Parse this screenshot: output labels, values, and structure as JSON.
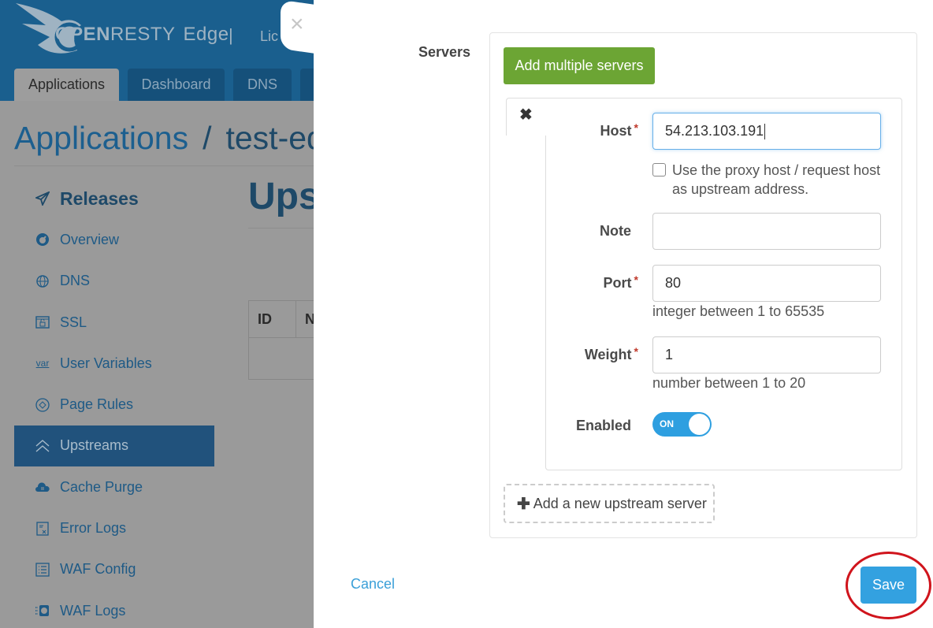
{
  "app": {
    "brand_open": "OPEN",
    "brand_resty": "RESTY",
    "brand_edge": "Edge",
    "separator": "|",
    "license_partial": "Lic"
  },
  "nav_tabs": [
    {
      "label": "Applications",
      "active": true
    },
    {
      "label": "Dashboard",
      "active": false
    },
    {
      "label": "DNS",
      "active": false
    }
  ],
  "breadcrumb": {
    "root": "Applications",
    "separator": "/",
    "current_partial": "test-ed"
  },
  "sidebar": {
    "items": [
      {
        "label": "Releases",
        "icon": "paper-plane-icon"
      },
      {
        "label": "Overview",
        "icon": "gauge-icon"
      },
      {
        "label": "DNS",
        "icon": "dns-globe-icon"
      },
      {
        "label": "SSL",
        "icon": "ssl-lock-icon"
      },
      {
        "label": "User Variables",
        "icon": "var-icon"
      },
      {
        "label": "Page Rules",
        "icon": "page-rules-icon"
      },
      {
        "label": "Upstreams",
        "icon": "upstreams-icon",
        "active": true
      },
      {
        "label": "Cache Purge",
        "icon": "cloud-icon"
      },
      {
        "label": "Error Logs",
        "icon": "error-log-icon"
      },
      {
        "label": "WAF Config",
        "icon": "list-icon"
      },
      {
        "label": "WAF Logs",
        "icon": "waf-logs-icon"
      }
    ]
  },
  "page": {
    "title_partial": "Ups",
    "table_headers": [
      "ID",
      "N"
    ]
  },
  "modal": {
    "close_symbol": "×",
    "servers_label": "Servers",
    "add_multiple_label": "Add multiple servers",
    "server": {
      "remove_symbol": "✖",
      "host_label": "Host",
      "host_value": "54.213.103.191",
      "use_proxy_host_label": "Use the proxy host / request host as upstream address.",
      "use_proxy_host_checked": false,
      "note_label": "Note",
      "note_value": "",
      "port_label": "Port",
      "port_value": "80",
      "port_help": "integer between 1 to 65535",
      "weight_label": "Weight",
      "weight_value": "1",
      "weight_help": "number between 1 to 20",
      "enabled_label": "Enabled",
      "enabled_state": "ON",
      "required_mark": "*"
    },
    "add_new_server_label": "Add a new upstream server",
    "add_new_plus": "✚",
    "cancel_label": "Cancel",
    "save_label": "Save"
  },
  "colors": {
    "header_blue": "#1a5f8e",
    "add_multiple_green": "#6ca534",
    "save_blue": "#33a1e0",
    "toggle_on": "#2e9fe0",
    "highlight_ring": "#d0141c"
  }
}
